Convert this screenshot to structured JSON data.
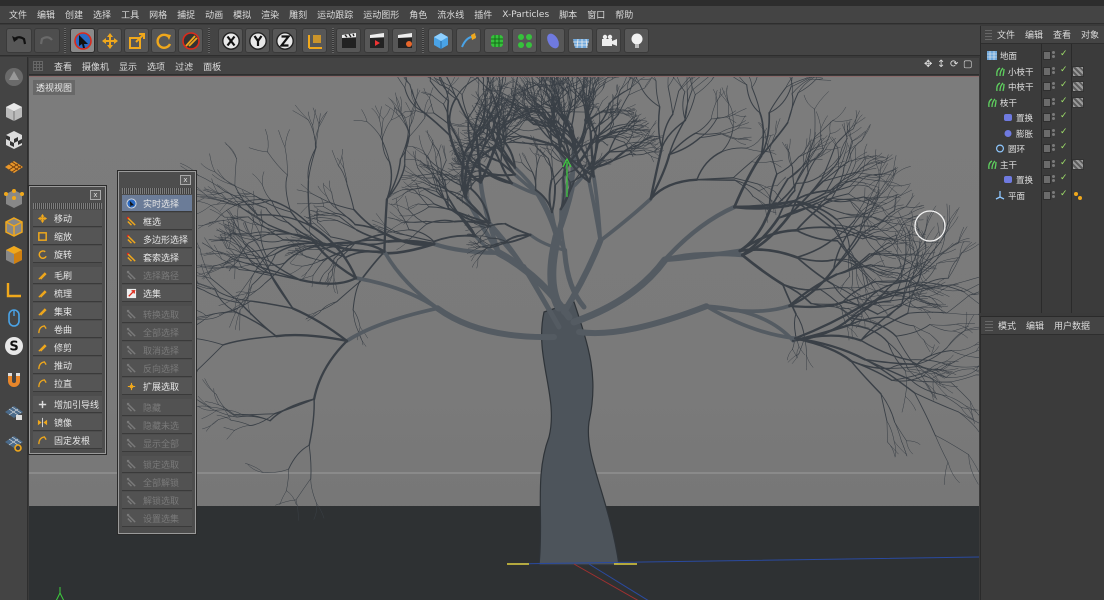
{
  "menubar": [
    "文件",
    "编辑",
    "创建",
    "选择",
    "工具",
    "网格",
    "捕捉",
    "动画",
    "模拟",
    "渲染",
    "雕刻",
    "运动跟踪",
    "运动图形",
    "角色",
    "流水线",
    "插件",
    "X-Particles",
    "脚本",
    "窗口",
    "帮助"
  ],
  "viewport": {
    "menu": [
      "查看",
      "摄像机",
      "显示",
      "选项",
      "过滤",
      "面板"
    ],
    "label": "透视视图"
  },
  "panel_left": {
    "items": [
      {
        "label": "移动",
        "group": 0
      },
      {
        "label": "缩放",
        "group": 0
      },
      {
        "label": "旋转",
        "group": 0
      },
      {
        "label": "毛刷",
        "group": 1
      },
      {
        "label": "梳理",
        "group": 1
      },
      {
        "label": "集束",
        "group": 1
      },
      {
        "label": "卷曲",
        "group": 1
      },
      {
        "label": "修剪",
        "group": 1
      },
      {
        "label": "推动",
        "group": 1
      },
      {
        "label": "拉直",
        "group": 1
      },
      {
        "label": "增加引导线",
        "group": 2
      },
      {
        "label": "镜像",
        "group": 2
      },
      {
        "label": "固定发根",
        "group": 2
      }
    ]
  },
  "panel_select": {
    "items": [
      {
        "label": "实时选择",
        "selected": true,
        "disabled": false
      },
      {
        "label": "框选",
        "selected": false,
        "disabled": false
      },
      {
        "label": "多边形选择",
        "selected": false,
        "disabled": false
      },
      {
        "label": "套索选择",
        "selected": false,
        "disabled": false
      },
      {
        "label": "选择路径",
        "selected": false,
        "disabled": true
      },
      {
        "label": "选集",
        "selected": false,
        "disabled": false
      },
      {
        "label": "转换选取",
        "selected": false,
        "disabled": true
      },
      {
        "label": "全部选择",
        "selected": false,
        "disabled": true
      },
      {
        "label": "取消选择",
        "selected": false,
        "disabled": true
      },
      {
        "label": "反向选择",
        "selected": false,
        "disabled": true
      },
      {
        "label": "扩展选取",
        "selected": false,
        "disabled": false
      },
      {
        "label": "隐藏",
        "selected": false,
        "disabled": true
      },
      {
        "label": "隐藏未选",
        "selected": false,
        "disabled": true
      },
      {
        "label": "显示全部",
        "selected": false,
        "disabled": true
      },
      {
        "label": "锁定选取",
        "selected": false,
        "disabled": true
      },
      {
        "label": "全部解锁",
        "selected": false,
        "disabled": true
      },
      {
        "label": "解锁选取",
        "selected": false,
        "disabled": true
      },
      {
        "label": "设置选集",
        "selected": false,
        "disabled": true
      }
    ]
  },
  "object_manager": {
    "menu": [
      "文件",
      "编辑",
      "查看",
      "对象"
    ],
    "objects": [
      {
        "name": "地面",
        "indent": 0,
        "icon": "floor-icon",
        "tag": "none"
      },
      {
        "name": "小枝干",
        "indent": 1,
        "icon": "hair-icon",
        "tag": "material"
      },
      {
        "name": "中枝干",
        "indent": 1,
        "icon": "hair-icon",
        "tag": "material"
      },
      {
        "name": "枝干",
        "indent": 0,
        "icon": "hair-icon",
        "tag": "material"
      },
      {
        "name": "置换",
        "indent": 2,
        "icon": "displace-icon",
        "tag": "none"
      },
      {
        "name": "膨胀",
        "indent": 2,
        "icon": "bulge-icon",
        "tag": "none"
      },
      {
        "name": "圆环",
        "indent": 1,
        "icon": "circle-icon",
        "tag": "none"
      },
      {
        "name": "主干",
        "indent": 0,
        "icon": "hair-icon",
        "tag": "material"
      },
      {
        "name": "置换",
        "indent": 2,
        "icon": "displace-icon",
        "tag": "none"
      },
      {
        "name": "平面",
        "indent": 1,
        "icon": "plane-icon",
        "tag": "dots"
      }
    ]
  },
  "attribute_manager": {
    "menu": [
      "模式",
      "编辑",
      "用户数据"
    ]
  },
  "colors": {
    "accent": "#6b7c98",
    "checkmark": "#9fe06a",
    "hair_icon": "#5fd05f",
    "ground": "#2e3133"
  }
}
